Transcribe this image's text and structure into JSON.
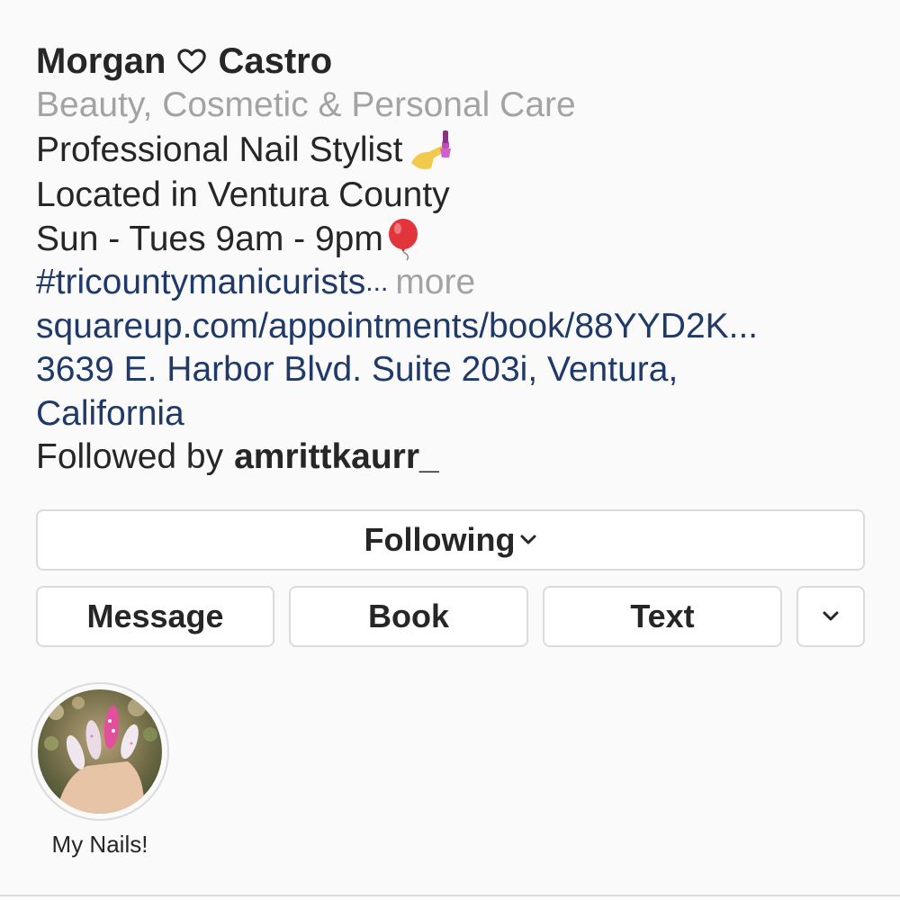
{
  "profile": {
    "name_first": "Morgan",
    "name_last": "Castro",
    "category": "Beauty, Cosmetic & Personal Care",
    "bio_line1": "Professional Nail Stylist",
    "bio_line2": "Located in Ventura County",
    "bio_line3": "Sun - Tues 9am - 9pm",
    "hashtag": "#tricountymanicurists",
    "ellipsis": "...",
    "more": "more",
    "website": "squareup.com/appointments/book/88YYD2K...",
    "address_line1": "3639 E. Harbor Blvd. Suite 203i, Ventura,",
    "address_line2": "California",
    "followed_by_prefix": "Followed by",
    "followed_by_user": "amrittkaurr_"
  },
  "actions": {
    "following": "Following",
    "message": "Message",
    "book": "Book",
    "text": "Text"
  },
  "highlights": [
    {
      "label": "My Nails!"
    }
  ],
  "icons": {
    "heart": "heart-outline-icon",
    "nail_polish": "nail-polish-emoji",
    "balloon": "balloon-emoji",
    "chevron": "chevron-down-icon"
  },
  "colors": {
    "link": "#1f3a68",
    "muted": "#a3a3a3",
    "text": "#262626",
    "border": "#dbdbdb",
    "background": "#fafafa"
  }
}
